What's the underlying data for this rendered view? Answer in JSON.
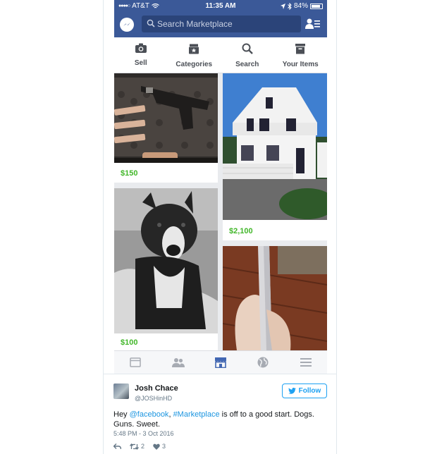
{
  "status_bar": {
    "carrier": "AT&T",
    "time": "11:35 AM",
    "battery": "84%"
  },
  "search": {
    "placeholder": "Search Marketplace"
  },
  "tabs": [
    {
      "label": "Sell",
      "icon": "camera-icon"
    },
    {
      "label": "Categories",
      "icon": "categories-icon"
    },
    {
      "label": "Search",
      "icon": "search-icon"
    },
    {
      "label": "Your Items",
      "icon": "inbox-icon"
    }
  ],
  "listings": [
    {
      "price": "$150",
      "image": "handgun in case"
    },
    {
      "price": "$2,100",
      "image": "white house"
    },
    {
      "price": "$100",
      "image": "dog"
    },
    {
      "image": "phone in hand"
    }
  ],
  "bottom_nav": [
    "news-feed-icon",
    "friends-icon",
    "marketplace-icon",
    "globe-icon",
    "menu-icon"
  ],
  "tweet": {
    "name": "Josh Chace",
    "handle": "@JOSHinHD",
    "follow_label": "Follow",
    "text_prefix": "Hey ",
    "mention": "@facebook",
    "text_mid": ", ",
    "hashtag": "#Marketplace",
    "text_suffix": " is off to a good start. Dogs. Guns. Sweet.",
    "timestamp": "5:48 PM - 3 Oct 2016",
    "retweets": "2",
    "likes": "3"
  },
  "colors": {
    "facebook_blue": "#3b5998",
    "price_green": "#42b72a",
    "twitter_blue": "#1da1f2"
  }
}
